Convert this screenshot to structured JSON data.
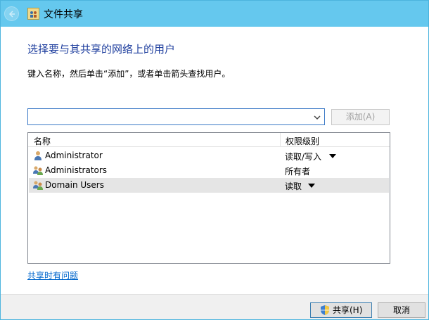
{
  "window": {
    "title": "文件共享"
  },
  "dialog": {
    "heading": "选择要与其共享的网络上的用户",
    "instruction": "键入名称，然后单击“添加”，或者单击箭头查找用户。",
    "combo_value": "",
    "add_button": "添加(A)"
  },
  "list": {
    "headers": {
      "name": "名称",
      "permission": "权限级别"
    },
    "rows": [
      {
        "name": "Administrator",
        "permission": "读取/写入",
        "icon": "user-icon",
        "has_dropdown": true,
        "selected": false
      },
      {
        "name": "Administrators",
        "permission": "所有者",
        "icon": "group-icon",
        "has_dropdown": false,
        "selected": false
      },
      {
        "name": "Domain Users",
        "permission": "读取",
        "icon": "group-icon",
        "has_dropdown": true,
        "selected": true
      }
    ]
  },
  "help_link": "共享时有问题",
  "footer": {
    "share_button": "共享(H)",
    "cancel_button": "取消"
  },
  "colors": {
    "titlebar": "#65c8ee",
    "heading": "#1e3e9e",
    "link": "#0066cc",
    "selected_row": "#e5e5e5"
  }
}
